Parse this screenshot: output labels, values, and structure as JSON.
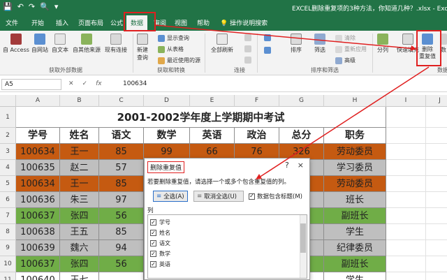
{
  "window": {
    "doc_title": "EXCEL删除重复项的3种方法，你知道几种？.xlsx - Excel",
    "app_name": "Excel"
  },
  "tabs": [
    {
      "label": "文件"
    },
    {
      "label": "开始"
    },
    {
      "label": "插入"
    },
    {
      "label": "页面布局"
    },
    {
      "label": "公式"
    },
    {
      "label": "数据"
    },
    {
      "label": "审阅"
    },
    {
      "label": "视图"
    },
    {
      "label": "帮助"
    },
    {
      "label": "操作说明搜索"
    }
  ],
  "ribbon": {
    "get_external": {
      "label": "获取外部数据",
      "buttons": [
        "自 Access",
        "自网站",
        "自文本",
        "自其他来源",
        "现有连接"
      ]
    },
    "transform": {
      "label": "获取和转换",
      "new_query": "新建\n查询",
      "show_query": "显示查询",
      "from_table": "从表格",
      "recent_sources": "最近使用的源"
    },
    "connections": {
      "label": "连接",
      "refresh_all": "全部刷新"
    },
    "sort_filter": {
      "label": "排序和筛选",
      "sort": "排序",
      "filter": "筛选",
      "clear": "清除",
      "reapply": "重新应用",
      "advanced": "高级"
    },
    "data_tools": {
      "label": "数据",
      "split": "分列",
      "flash_fill": "快速填充",
      "remove_dup_line1": "删除",
      "remove_dup_line2": "重复值",
      "more": "数"
    }
  },
  "formula_bar": {
    "name_box": "A5",
    "value": "100634"
  },
  "grid": {
    "columns": [
      "A",
      "B",
      "C",
      "D",
      "E",
      "F",
      "G",
      "H",
      "I",
      "J"
    ],
    "rows": [
      "1",
      "2",
      "3",
      "4",
      "5",
      "6",
      "7",
      "8",
      "9",
      "10",
      "11"
    ],
    "title": "2001-2002学年度上学期期中考试",
    "header": [
      "学号",
      "姓名",
      "语文",
      "数学",
      "英语",
      "政治",
      "总分",
      "职务"
    ],
    "data": [
      [
        "100634",
        "王一",
        "85",
        "99",
        "66",
        "76",
        "326",
        "劳动委员"
      ],
      [
        "100635",
        "赵二",
        "57",
        "",
        "",
        "",
        "",
        "学习委员"
      ],
      [
        "100634",
        "王一",
        "85",
        "",
        "",
        "",
        "",
        "劳动委员"
      ],
      [
        "100636",
        "朱三",
        "97",
        "",
        "",
        "",
        "",
        "班长"
      ],
      [
        "100637",
        "张四",
        "56",
        "",
        "",
        "",
        "",
        "副班长"
      ],
      [
        "100638",
        "王五",
        "85",
        "",
        "",
        "",
        "",
        "学生"
      ],
      [
        "100639",
        "魏六",
        "94",
        "",
        "",
        "",
        "",
        "纪律委员"
      ],
      [
        "100637",
        "张四",
        "56",
        "",
        "",
        "",
        "",
        "副班长"
      ],
      [
        "100640",
        "王七",
        "",
        "",
        "",
        "",
        "",
        "学生"
      ]
    ],
    "row_colors": [
      "#c55a11",
      "#bfbfbf",
      "#c55a11",
      "#bfbfbf",
      "#70ad47",
      "#bfbfbf",
      "#bfbfbf",
      "#70ad47",
      "#ffffff"
    ]
  },
  "dialog": {
    "title": "删除重复值",
    "help": "?",
    "close": "×",
    "description": "若要删除重复值，请选择一个或多个包含重复值的列。",
    "select_all": "全选(A)",
    "unselect_all": "取消全选(U)",
    "has_headers": "数据包含标题(M)",
    "list_label": "列",
    "columns": [
      "学号",
      "姓名",
      "语文",
      "数学",
      "英语"
    ]
  },
  "colors": {
    "excel_green": "#217346",
    "annotation_red": "#e02020"
  }
}
